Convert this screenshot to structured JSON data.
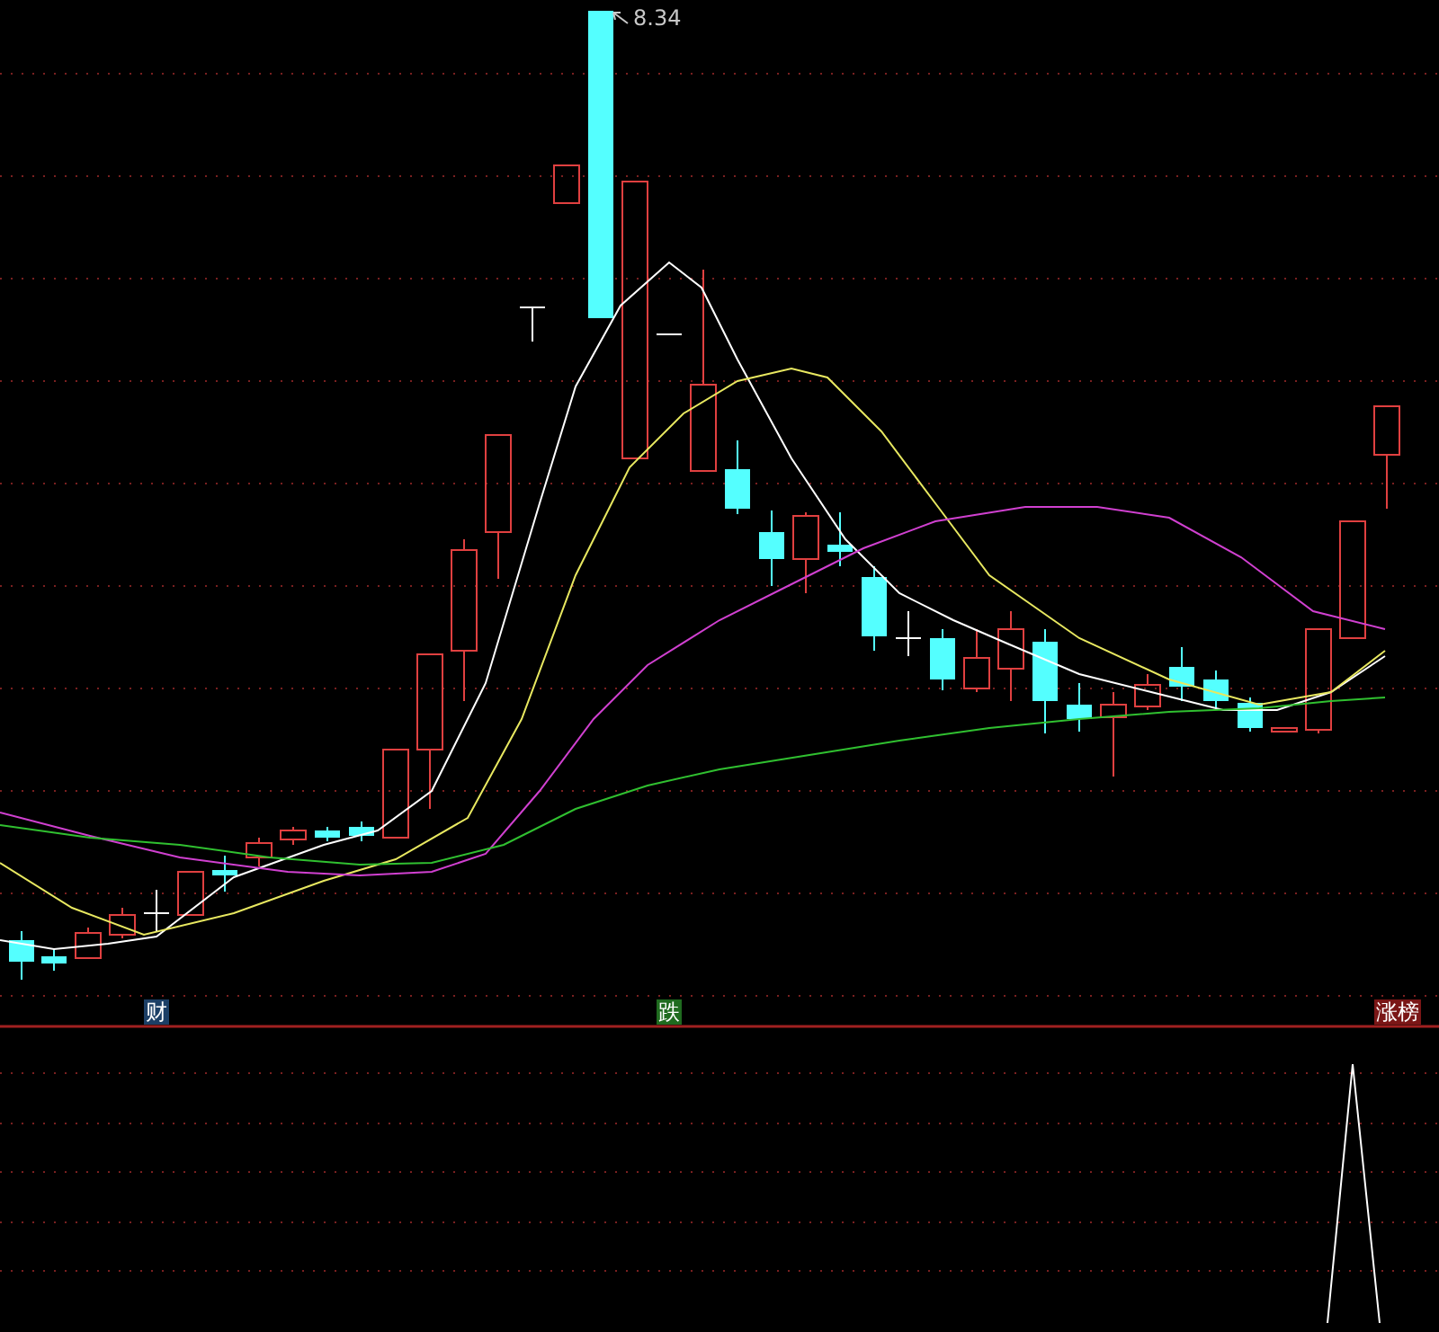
{
  "price_chart": {
    "high_label": "8.34",
    "signals": [
      {
        "label": "财",
        "color": "#1c3f66"
      },
      {
        "label": "跌",
        "color": "#1f6b1f"
      },
      {
        "label": "涨榜",
        "color": "#7a1616"
      }
    ]
  }
}
